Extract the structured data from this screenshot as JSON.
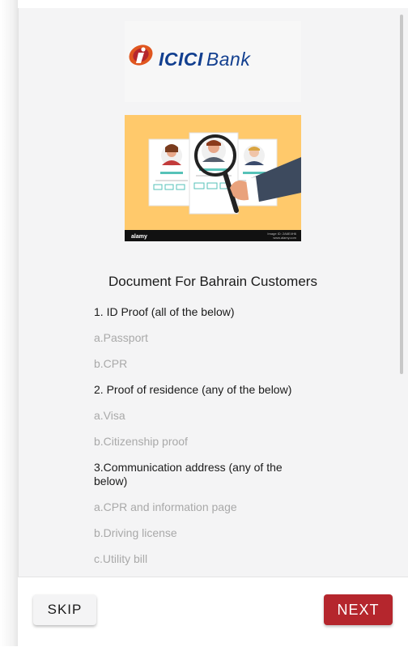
{
  "brand": {
    "logo_name": "ICICI",
    "logo_suffix": "Bank",
    "brand_color": "#123f8f",
    "mark_color": "#e0561f"
  },
  "illustration": {
    "watermark": "alamy",
    "caption_lines": [
      "Image ID: 2A6E4H6",
      "www.alamy.com"
    ],
    "bg_color": "#ffc96b"
  },
  "content": {
    "title": "Document For Bahrain Customers",
    "items": [
      {
        "text": "1. ID Proof (all of the below)",
        "kind": "head"
      },
      {
        "text": "a.Passport",
        "kind": "sub"
      },
      {
        "text": "b.CPR",
        "kind": "sub"
      },
      {
        "text": "2. Proof of residence (any of the below)",
        "kind": "head"
      },
      {
        "text": "a.Visa",
        "kind": "sub"
      },
      {
        "text": "b.Citizenship proof",
        "kind": "sub"
      },
      {
        "text": "3.Communication address (any of the below)",
        "kind": "head"
      },
      {
        "text": "a.CPR and information page",
        "kind": "sub"
      },
      {
        "text": "b.Driving license",
        "kind": "sub"
      },
      {
        "text": "c.Utility bill",
        "kind": "sub"
      }
    ]
  },
  "footer": {
    "skip_label": "SKIP",
    "next_label": "NEXT",
    "next_color": "#b5262d"
  }
}
